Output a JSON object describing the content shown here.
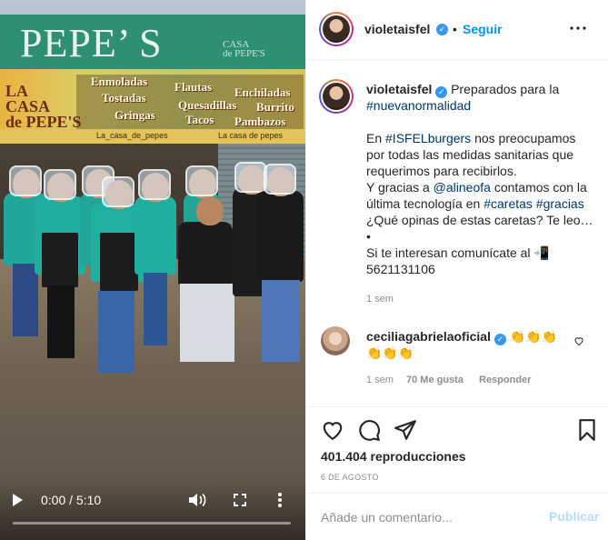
{
  "video": {
    "sign_text": "PEPE’ S",
    "sign_logo": "CASA\nde PEPE'S",
    "banner_logo": "LA\nCASA\nde PEPE'S",
    "menu": [
      "Enmoladas",
      "Flautas",
      "Enchiladas",
      "Tostadas",
      "Quesadillas",
      "Burrito",
      "Gringas",
      "Tacos",
      "Pambazos"
    ],
    "handles": [
      "La_casa_de_pepes",
      "La casa de pepes"
    ],
    "time": "0:00 / 5:10",
    "progress": 0
  },
  "header": {
    "username": "violetaisfel",
    "dot": "•",
    "follow_label": "Seguir"
  },
  "caption": {
    "username": "violetaisfel",
    "line1": "Preparados para la",
    "hashtag_nueva": "#nuevanormalidad",
    "line3_pre": "En ",
    "hashtag_isfel": "#ISFELburgers",
    "line3_post": " nos preocupamos",
    "line4": "por todas las medidas sanitarias que",
    "line5": "requerimos para recibirlos.",
    "line6_pre": "Y gracias a ",
    "mention": "@alineofa",
    "line6_post": " contamos con la",
    "line7_pre": "última tecnología en ",
    "hashtag_caretas": "#caretas",
    "hashtag_gracias": "#gracias",
    "line8": "¿Qué opinas de estas caretas? Te leo…",
    "bullet": "•",
    "line9": "Si te interesan comunícate al 📲",
    "phone": "5621131106",
    "time_ago": "1 sem"
  },
  "comment": {
    "username": "ceciliagabrielaoficial",
    "text_line1": "👏👏👏",
    "text_line2": "👏👏👏",
    "time_ago": "1 sem",
    "likes": "70 Me gusta",
    "reply_label": "Responder"
  },
  "stats": {
    "views": "401.404 reproducciones",
    "date": "6 DE AGOSTO"
  },
  "comment_box": {
    "placeholder": "Añade un comentario...",
    "publish_label": "Publicar"
  },
  "colors": {
    "link": "#0095f6",
    "hashtag": "#00376b",
    "verified": "#3897f0",
    "muted": "#8e8e8e",
    "publish_disabled": "#b3dbff"
  },
  "icons": [
    "play-icon",
    "volume-icon",
    "fullscreen-icon",
    "more-vertical-icon",
    "verified-icon",
    "options-icon",
    "heart-icon",
    "comment-icon",
    "share-icon",
    "bookmark-icon",
    "small-heart-icon"
  ]
}
